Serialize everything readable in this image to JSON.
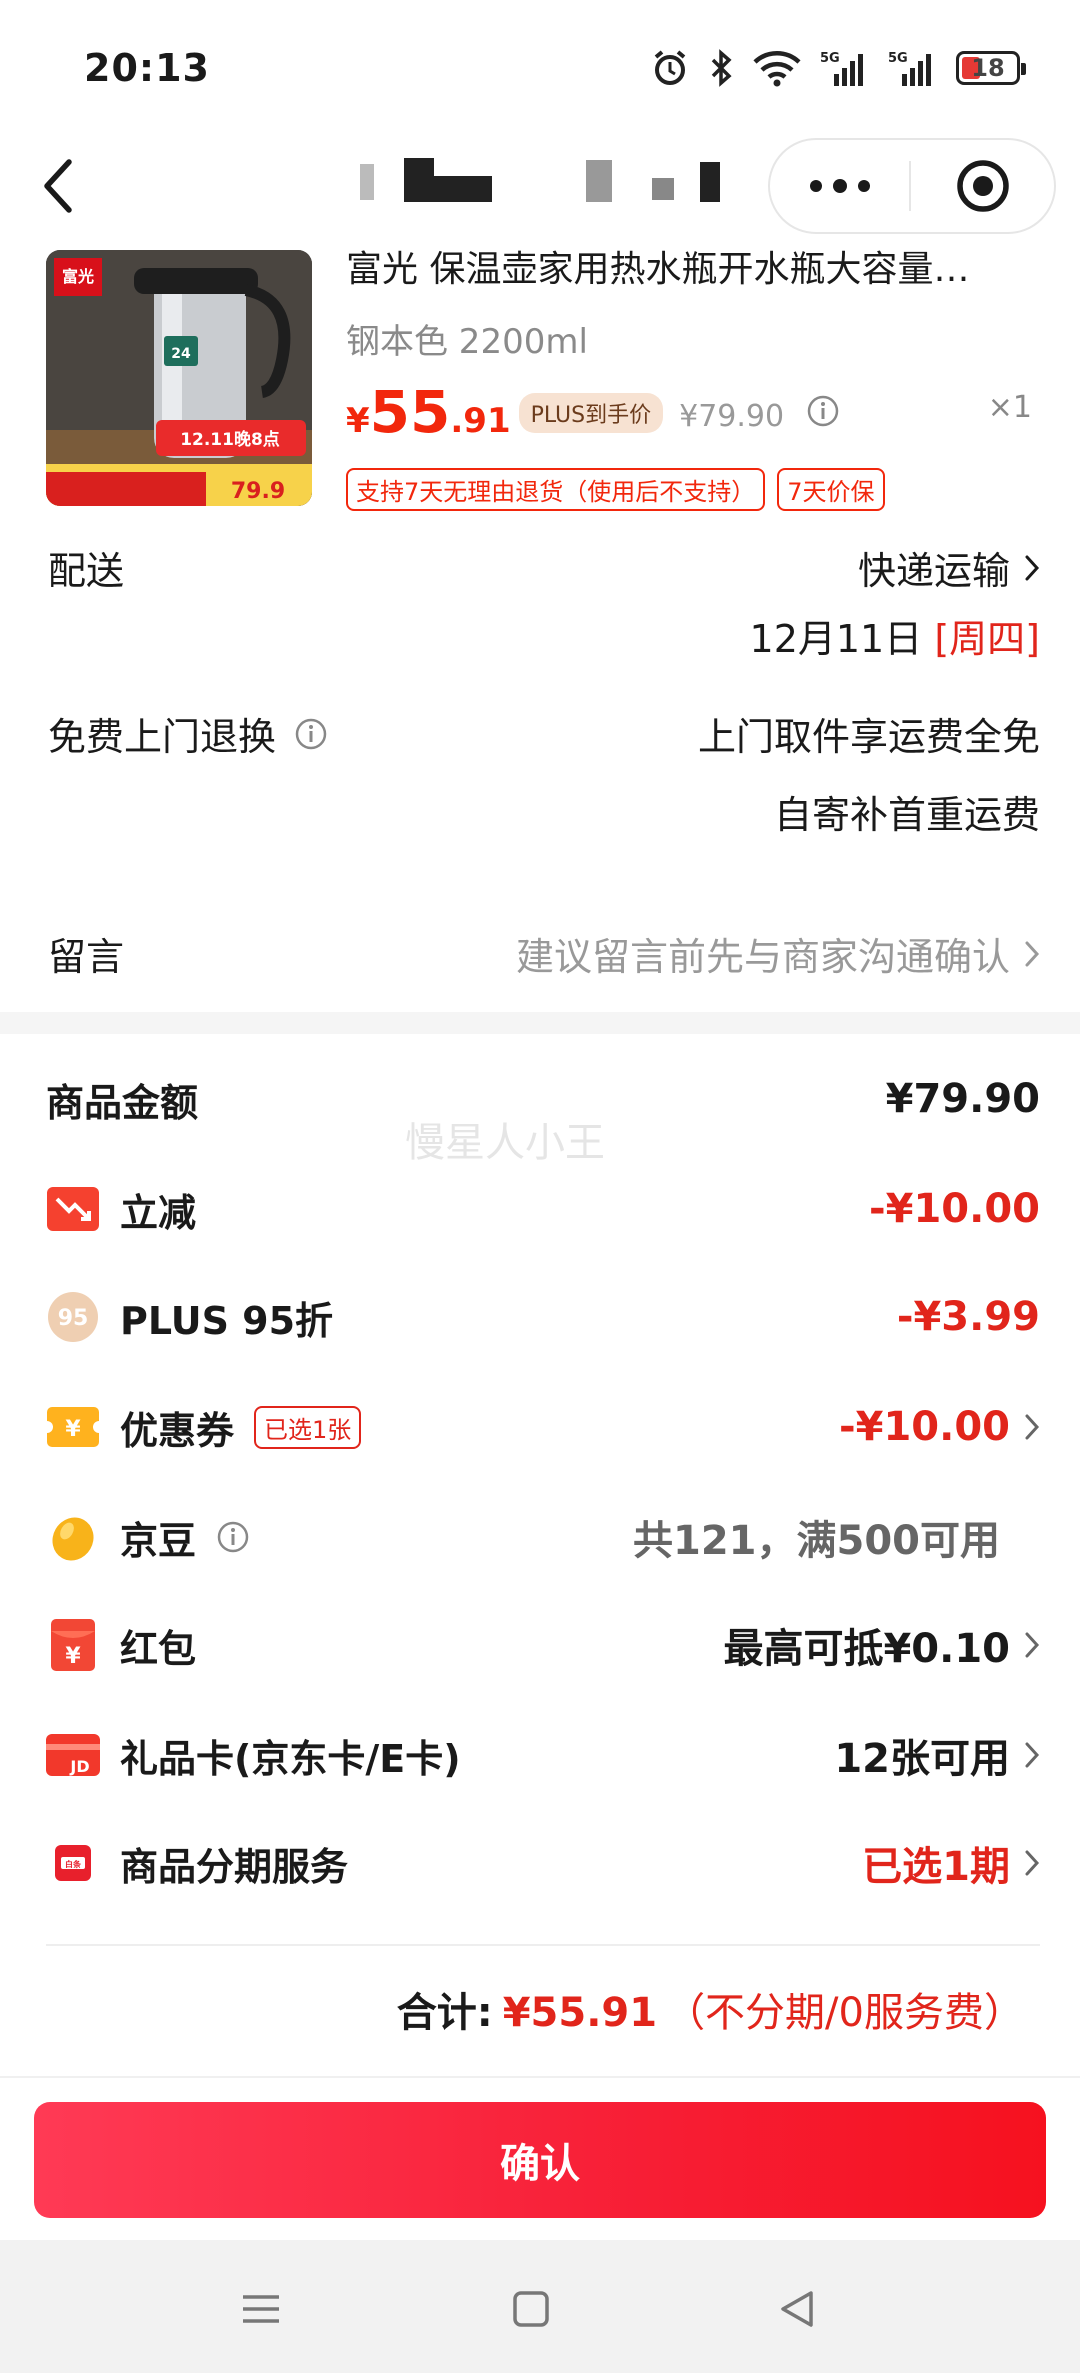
{
  "status_bar": {
    "time": "20:13",
    "battery": "18",
    "net1": "5G",
    "net2": "5G"
  },
  "product": {
    "image_badge": "富光",
    "image_promo": "12.11晚8点",
    "image_price": "79.9",
    "name": "富光 保温壶家用热水瓶开水瓶大容量…",
    "spec": "钢本色 2200ml",
    "price_symbol": "¥",
    "price_int": "55",
    "price_dec": ".91",
    "plus_tag": "PLUS到手价",
    "original_price": "¥79.90",
    "quantity": "×1",
    "tags": [
      "支持7天无理由退货（使用后不支持）",
      "7天价保"
    ]
  },
  "delivery": {
    "label": "配送",
    "method": "快递运输",
    "date": "12月11日",
    "weekday": "[周四]"
  },
  "returns": {
    "label": "免费上门退换",
    "line1": "上门取件享运费全免",
    "line2": "自寄补首重运费"
  },
  "note": {
    "label": "留言",
    "placeholder": "建议留言前先与商家沟通确认"
  },
  "watermark": "慢星人小王",
  "summary": {
    "goods_amount_label": "商品金额",
    "goods_amount": "¥79.90",
    "instant_label": "立减",
    "instant_value": "-¥10.00",
    "plus_label": "PLUS 95折",
    "plus_icon_text": "95",
    "plus_value": "-¥3.99",
    "coupon_label": "优惠券",
    "coupon_tag": "已选1张",
    "coupon_value": "-¥10.00",
    "jd_bean_label": "京豆",
    "jd_bean_value": "共121，满500可用",
    "red_packet_label": "红包",
    "red_packet_value": "最高可抵¥0.10",
    "giftcard_label": "礼品卡(京东卡/E卡)",
    "giftcard_value": "12张可用",
    "installment_label": "商品分期服务",
    "installment_value": "已选1期"
  },
  "total": {
    "label": "合计:",
    "amount": "¥55.91",
    "note": "（不分期/0服务费）"
  },
  "confirm_label": "确认",
  "colors": {
    "accent_red": "#e1251b",
    "price_red": "#f2270c",
    "button_red": "#f71e35"
  }
}
